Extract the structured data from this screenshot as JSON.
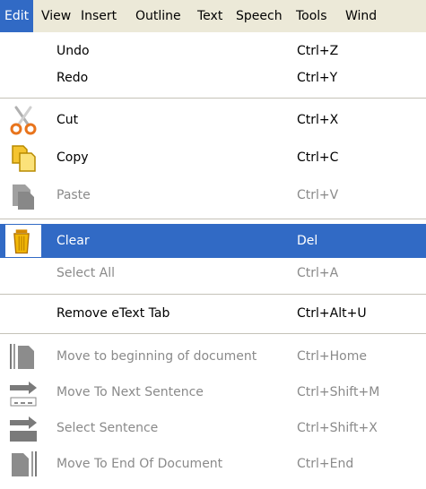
{
  "menubar": {
    "items": [
      {
        "label": "Edit"
      },
      {
        "label": "View"
      },
      {
        "label": "Insert"
      },
      {
        "label": "Outline"
      },
      {
        "label": "Text"
      },
      {
        "label": "Speech"
      },
      {
        "label": "Tools"
      },
      {
        "label": "Wind"
      }
    ]
  },
  "edit_menu": {
    "items": [
      {
        "label": "Undo",
        "shortcut": "Ctrl+Z",
        "enabled": true
      },
      {
        "label": "Redo",
        "shortcut": "Ctrl+Y",
        "enabled": true
      },
      {
        "label": "Cut",
        "shortcut": "Ctrl+X",
        "enabled": true,
        "icon": "scissors-icon"
      },
      {
        "label": "Copy",
        "shortcut": "Ctrl+C",
        "enabled": true,
        "icon": "copy-icon"
      },
      {
        "label": "Paste",
        "shortcut": "Ctrl+V",
        "enabled": false,
        "icon": "paste-icon"
      },
      {
        "label": "Clear",
        "shortcut": "Del",
        "enabled": true,
        "highlighted": true,
        "icon": "trash-icon"
      },
      {
        "label": "Select All",
        "shortcut": "Ctrl+A",
        "enabled": false
      },
      {
        "label": "Remove eText Tab",
        "shortcut": "Ctrl+Alt+U",
        "enabled": true
      },
      {
        "label": "Move to beginning of document",
        "shortcut": "Ctrl+Home",
        "enabled": false,
        "icon": "move-to-beginning-icon"
      },
      {
        "label": "Move To Next Sentence",
        "shortcut": "Ctrl+Shift+M",
        "enabled": false,
        "icon": "next-sentence-icon"
      },
      {
        "label": "Select Sentence",
        "shortcut": "Ctrl+Shift+X",
        "enabled": false,
        "icon": "select-sentence-icon"
      },
      {
        "label": "Move To End Of Document",
        "shortcut": "Ctrl+End",
        "enabled": false,
        "icon": "move-to-end-icon"
      }
    ]
  },
  "colors": {
    "highlight": "#316ac5",
    "menubar_bg": "#ece9d8",
    "disabled_text": "#8a8a8a"
  }
}
